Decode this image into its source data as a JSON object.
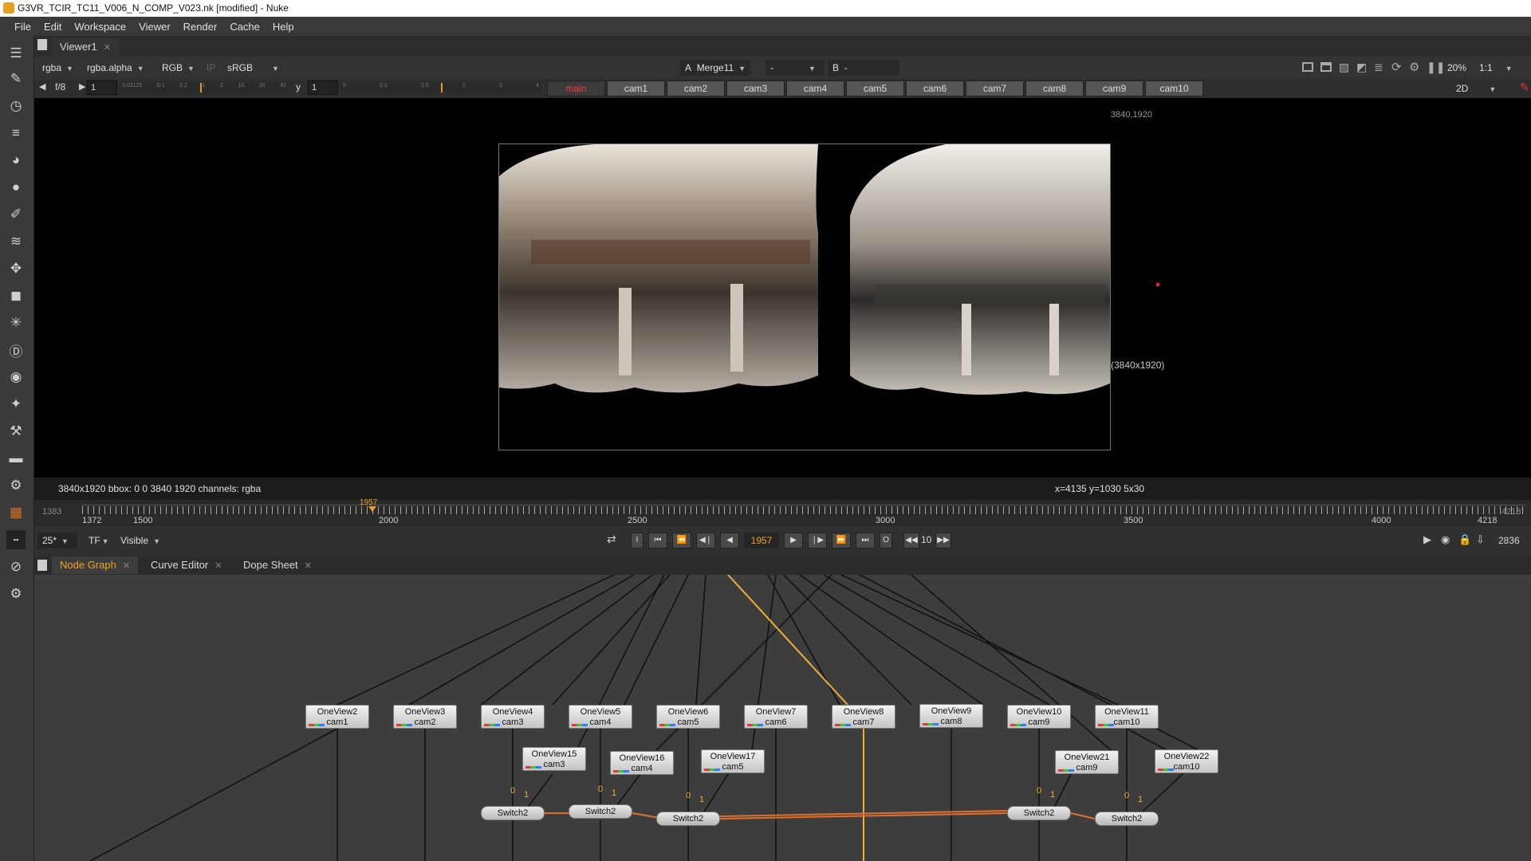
{
  "window": {
    "title": "G3VR_TCIR_TC11_V006_N_COMP_V023.nk [modified] - Nuke"
  },
  "menu": [
    "File",
    "Edit",
    "Workspace",
    "Viewer",
    "Render",
    "Cache",
    "Help"
  ],
  "viewer_tab": {
    "label": "Viewer1"
  },
  "viewer_controls": {
    "channels": "rgba",
    "alpha_channel": "rgba.alpha",
    "display": "RGB",
    "ip": "IP",
    "lut": "sRGB",
    "a_label": "A",
    "a_input": "Merge11",
    "a_op": "-",
    "b_label": "B",
    "b_input": "-",
    "zoom": "20%",
    "ratio": "1:1",
    "fstop": "f/8",
    "gain": "1",
    "y_label": "y",
    "gamma": "1",
    "view_mode": "2D",
    "gain_ticks": [
      "0.03125",
      "0.1",
      "0.2",
      "1",
      "2",
      "10",
      "20",
      "40"
    ],
    "gamma_ticks": [
      "0",
      "0.1",
      "0.5",
      "1",
      "2",
      "4"
    ]
  },
  "views": {
    "active": "main",
    "items": [
      "main",
      "cam1",
      "cam2",
      "cam3",
      "cam4",
      "cam5",
      "cam6",
      "cam7",
      "cam8",
      "cam9",
      "cam10"
    ]
  },
  "image": {
    "corner_label": "3840,1920",
    "size_label": "(3840x1920)"
  },
  "info": {
    "left": "3840x1920  bbox: 0 0 3840 1920 channels: rgba",
    "right": "x=4135 y=1030 5x30"
  },
  "timeline": {
    "in_frame": "1383",
    "out_frame": "4218",
    "current_marker": "1957",
    "labels": [
      "1372",
      "1500",
      "2000",
      "2500",
      "3000",
      "3500",
      "4000",
      "4218"
    ]
  },
  "playback": {
    "fps": "25*",
    "tf": "TF",
    "visibility": "Visible",
    "current_frame": "1957",
    "increment": "10",
    "end_frame": "2836",
    "in_btn": "I",
    "out_btn": "O"
  },
  "panels": [
    {
      "label": "Node Graph",
      "active": true
    },
    {
      "label": "Curve Editor",
      "active": false
    },
    {
      "label": "Dope Sheet",
      "active": false
    }
  ],
  "nodes": {
    "row1": [
      {
        "name": "OneView2",
        "view": "cam1"
      },
      {
        "name": "OneView3",
        "view": "cam2"
      },
      {
        "name": "OneView4",
        "view": "cam3"
      },
      {
        "name": "OneView5",
        "view": "cam4"
      },
      {
        "name": "OneView6",
        "view": "cam5"
      },
      {
        "name": "OneView7",
        "view": "cam6"
      },
      {
        "name": "OneView8",
        "view": "cam7"
      },
      {
        "name": "OneView9",
        "view": "cam8"
      },
      {
        "name": "OneView10",
        "view": "cam9"
      },
      {
        "name": "OneView11",
        "view": "cam10"
      }
    ],
    "row2": [
      {
        "name": "OneView15",
        "view": "cam3"
      },
      {
        "name": "OneView16",
        "view": "cam4"
      },
      {
        "name": "OneView17",
        "view": "cam5"
      },
      {
        "name": "OneView21",
        "view": "cam9"
      },
      {
        "name": "OneView22",
        "view": "cam10"
      }
    ],
    "switches": [
      "Switch2",
      "Switch2",
      "Switch2",
      "Switch2",
      "Switch2"
    ],
    "input_labels": {
      "zero": "0",
      "one": "1"
    }
  },
  "colors": {
    "accent_orange": "#f0a020",
    "active_view_red": "#ff3b3b",
    "selected_pipe": "#f0b030"
  }
}
